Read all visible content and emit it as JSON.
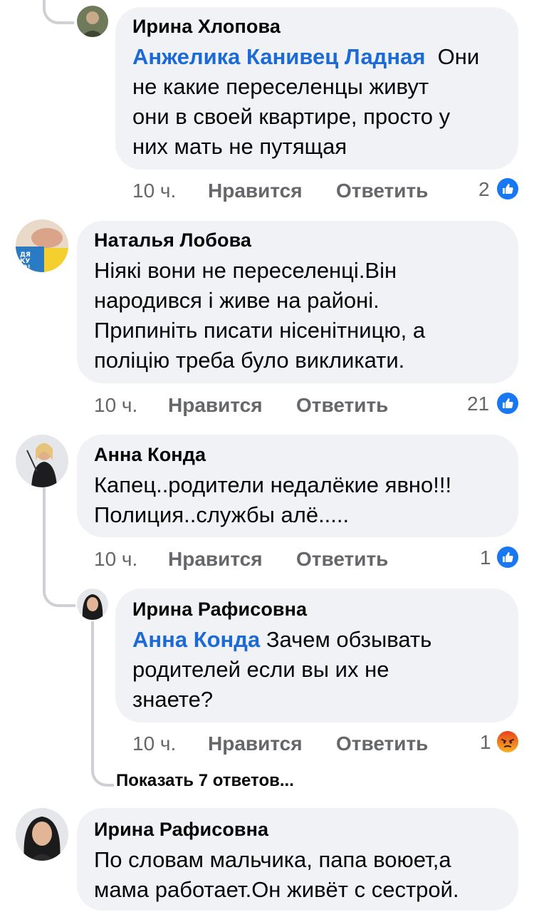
{
  "comments": [
    {
      "author": "Ирина Хлопова",
      "mention": "Анжелика Канивец Ладная",
      "line1": "Они",
      "lines": [
        "не какие переселенцы живут",
        "они в своей квартире, просто у",
        "них мать не путящая"
      ],
      "time": "10 ч.",
      "like": "Нравится",
      "reply": "Ответить",
      "reactions": "2",
      "reaction_icon": "like-icon"
    },
    {
      "author": "Наталья Лобова",
      "lines": [
        "Ніякі вони не переселенці.Він",
        "народився і живе на районі.",
        "Припиніть писати нісенітницю, а",
        "поліцію треба було викликати."
      ],
      "time": "10 ч.",
      "like": "Нравится",
      "reply": "Ответить",
      "reactions": "21",
      "reaction_icon": "like-icon",
      "avatar_badge": "ДЯ КУ Ю!"
    },
    {
      "author": "Анна Конда",
      "lines": [
        "Капец..родители недалёкие явно!!!",
        "Полиция..службы алё....."
      ],
      "time": "10 ч.",
      "like": "Нравится",
      "reply": "Ответить",
      "reactions": "1",
      "reaction_icon": "like-icon"
    },
    {
      "author": "Ирина Рафисовна",
      "mention": "Анна Конда",
      "line1": "Зачем обзывать",
      "lines": [
        "родителей если вы их не",
        "знаете?"
      ],
      "time": "10 ч.",
      "like": "Нравится",
      "reply": "Ответить",
      "reactions": "1",
      "reaction_icon": "angry-icon"
    },
    {
      "author": "Ирина Рафисовна",
      "lines": [
        "По словам мальчика, папа воюет,а",
        "мама работает.Он живёт с сестрой."
      ]
    }
  ],
  "show_replies": "Показать 7 ответов...",
  "colors": {
    "bubble": "#f0f2f5",
    "mention": "#1b6ad6",
    "meta": "#65676b",
    "like": "#1877f2",
    "angry": "#e9710f"
  }
}
